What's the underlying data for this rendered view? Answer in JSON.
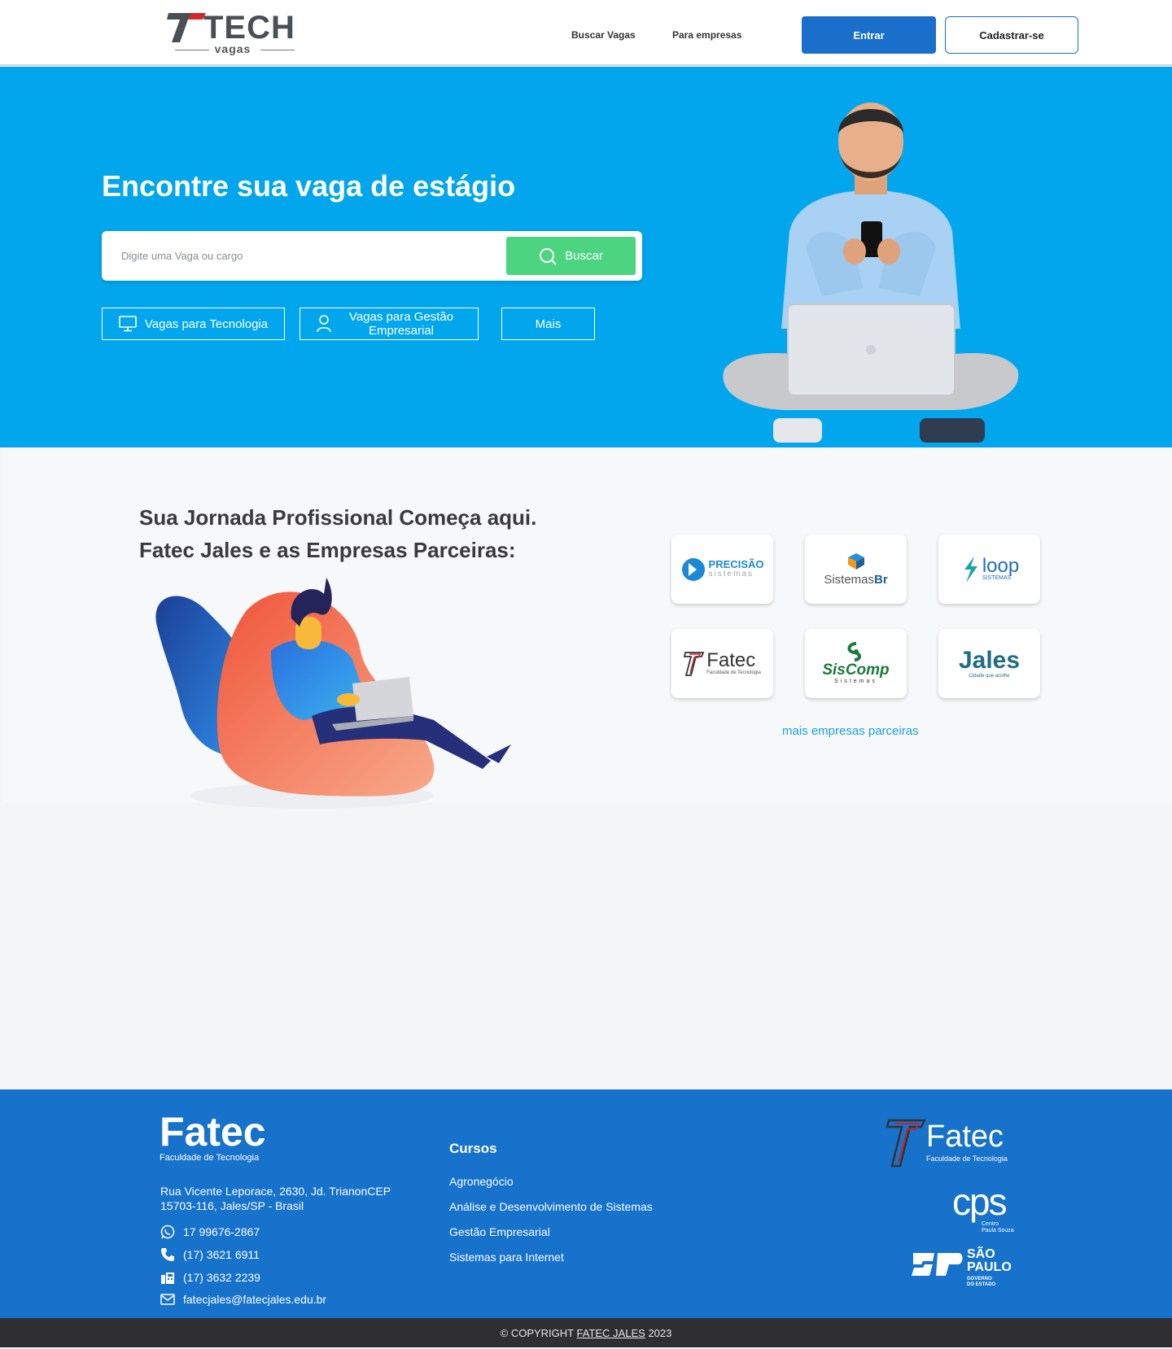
{
  "header": {
    "logo_text": "TECH",
    "logo_sub": "vagas",
    "nav": [
      "Buscar Vagas",
      "Para empresas"
    ],
    "login_label": "Entrar",
    "signup_label": "Cadastrar-se"
  },
  "hero": {
    "title": "Encontre sua vaga de estágio",
    "search_placeholder": "Digite uma Vaga ou cargo",
    "search_button": "Buscar",
    "categories": [
      "Vagas para Tecnologia",
      "Vagas para Gestão Empresarial",
      "Mais"
    ]
  },
  "partners_section": {
    "title_line1": "Sua Jornada Profissional Começa aqui.",
    "title_line2": "Fatec Jales e as Empresas Parceiras:",
    "partners": [
      {
        "name": "PRECISÃO",
        "sub": "sistemas"
      },
      {
        "name": "Sistemas",
        "name_bold": "Br"
      },
      {
        "name": "loop",
        "sub": "SISTEMAS"
      },
      {
        "name": "Fatec",
        "sub": "Faculdade de Tecnologia"
      },
      {
        "name": "SisComp",
        "sub": "Sistemas"
      },
      {
        "name": "Jales",
        "sub": "Cidade que acolhe"
      }
    ],
    "more_link": "mais empresas parceiras"
  },
  "footer": {
    "logo_main": "Fatec",
    "logo_sub": "Faculdade de Tecnologia",
    "address": "Rua Vicente Leporace, 2630, Jd. TrianonCEP 15703-116, Jales/SP - Brasil",
    "whatsapp": "17 99676-2867",
    "phone": "(17) 3621 6911",
    "fax": "(17) 3632 2239",
    "email": "fatecjales@fatecjales.edu.br",
    "cursos_title": "Cursos",
    "cursos": [
      "Agronegócio",
      "Análise e Desenvolvimento de Sistemas",
      "Gestão Empresarial",
      "Sistemas para Internet"
    ],
    "right_logos": {
      "fatec": "Fatec",
      "fatec_sub": "Faculdade de Tecnologia",
      "cps": "cps",
      "cps_sub1": "Centro",
      "cps_sub2": "Paula Souza",
      "sp_line1": "SÃO",
      "sp_line2": "PAULO",
      "sp_line3": "GOVERNO",
      "sp_line4": "DO ESTADO"
    }
  },
  "copyright": {
    "prefix": "© COPYRIGHT",
    "link": "FATEC JALES",
    "year": "2023"
  },
  "colors": {
    "brand_blue": "#1a6fcb",
    "hero_blue": "#02a6ec",
    "search_green": "#4cd480",
    "footer_blue": "#1772cb"
  }
}
